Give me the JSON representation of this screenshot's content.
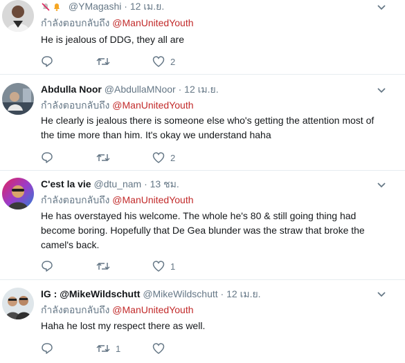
{
  "replying_prefix": "กำลังตอบกลับถึง",
  "tweets": [
    {
      "name": "",
      "handle": "@YMagashi",
      "time": "12 เม.ย.",
      "replying_to": "@ManUnitedYouth",
      "text": "He is jealous of DDG, they all are",
      "retweets": "",
      "likes": "2"
    },
    {
      "name": "Abdulla Noor",
      "handle": "@AbdullaMNoor",
      "time": "12 เม.ย.",
      "replying_to": "@ManUnitedYouth",
      "text": "He clearly is jealous there is someone else who's getting the attention most of the time more than him. It's okay we understand haha",
      "retweets": "",
      "likes": "2"
    },
    {
      "name": "C'est la vie",
      "handle": "@dtu_nam",
      "time": "13 ชม.",
      "replying_to": "@ManUnitedYouth",
      "text": "He has overstayed his welcome. The whole he's 80 & still going thing had become boring. Hopefully that De Gea blunder was the straw that broke the camel's back.",
      "retweets": "",
      "likes": "1"
    },
    {
      "name": "IG : @MikeWildschutt",
      "handle": "@MikeWildschutt",
      "time": "12 เม.ย.",
      "replying_to": "@ManUnitedYouth",
      "text": "Haha he lost my respect there as well.",
      "retweets": "1",
      "likes": ""
    }
  ],
  "colors": {
    "mention": "#c22a2a",
    "meta": "#657786",
    "divider": "#e6ecf0"
  },
  "icons": {
    "reply": "reply-icon",
    "retweet": "retweet-icon",
    "like": "heart-icon",
    "more": "chevron-down-icon"
  }
}
